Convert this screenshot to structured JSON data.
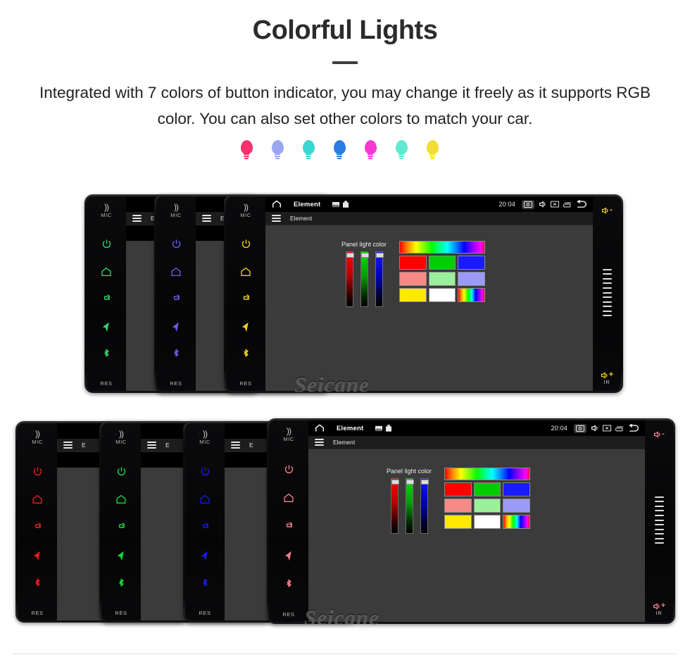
{
  "header": {
    "title": "Colorful Lights",
    "description": "Integrated with 7 colors of button indicator, you may change it freely as it supports RGB color. You can also set other colors to match your car."
  },
  "legend": {
    "icon": "bulb-icon",
    "items": [
      {
        "label": "red",
        "color": "#f8306b"
      },
      {
        "label": "Light blue",
        "color": "#9aa8f2"
      },
      {
        "label": "cyan",
        "color": "#3ad6d2"
      },
      {
        "label": "blue",
        "color": "#2a7de1"
      },
      {
        "label": "pink",
        "color": "#f738d0"
      },
      {
        "label": "light cyan",
        "color": "#62e8d0"
      },
      {
        "label": "yellow",
        "color": "#f2dd36"
      }
    ]
  },
  "device": {
    "brand_watermark": "Seicane",
    "left_panel": {
      "mic_label": "MIC",
      "reset_label": "RES",
      "keys": [
        {
          "name": "power-key",
          "icon": "power-icon"
        },
        {
          "name": "home-key",
          "icon": "home-icon"
        },
        {
          "name": "return-key",
          "icon": "return-arrow-icon"
        },
        {
          "name": "navigation-key",
          "icon": "navigation-arrow-icon"
        },
        {
          "name": "bluetooth-key",
          "icon": "bluetooth-icon"
        }
      ]
    },
    "right_panel": {
      "volume_down_label": "-",
      "volume_up_label": "+",
      "tick_count": 11,
      "ir_label": "IR"
    },
    "statusbar": {
      "home_icon": "home-icon",
      "title": "Element",
      "left_icons": [
        "image-icon",
        "usb-icon"
      ],
      "clock": "20:04",
      "right_icons": [
        "screenshot-icon",
        "mute-icon",
        "close-window-icon",
        "recents-icon",
        "back-icon"
      ]
    },
    "appbar": {
      "menu_icon": "hamburger-icon",
      "title": "Element"
    },
    "dialog": {
      "caption": "Panel light color",
      "sliders": [
        {
          "name": "red-slider",
          "value": 100
        },
        {
          "name": "green-slider",
          "value": 100
        },
        {
          "name": "blue-slider",
          "value": 100
        }
      ],
      "hue_strip": "hue-gradient",
      "swatch_rows": [
        [
          {
            "name": "swatch-red",
            "color": "#ff0000"
          },
          {
            "name": "swatch-green",
            "color": "#00cc00"
          },
          {
            "name": "swatch-blue",
            "color": "#1a1aff"
          }
        ],
        [
          {
            "name": "swatch-light-red",
            "color": "#f78a86"
          },
          {
            "name": "swatch-light-green",
            "color": "#9bf09b"
          },
          {
            "name": "swatch-light-blue",
            "color": "#9b9bf7"
          }
        ],
        [
          {
            "name": "swatch-yellow",
            "color": "#ffe800"
          },
          {
            "name": "swatch-white",
            "color": "#ffffff"
          },
          {
            "name": "swatch-rainbow",
            "color": "rainbow"
          }
        ]
      ]
    }
  },
  "groups": {
    "top": {
      "units": [
        {
          "name": "unit-green",
          "key_color": "#2fd66a"
        },
        {
          "name": "unit-purple",
          "key_color": "#6a5ce8"
        },
        {
          "name": "unit-yellow",
          "key_color": "#f0d11a"
        }
      ]
    },
    "bottom": {
      "units": [
        {
          "name": "unit-red",
          "key_color": "#ef1b24"
        },
        {
          "name": "unit-green",
          "key_color": "#19d93f"
        },
        {
          "name": "unit-blue",
          "key_color": "#1a1ae8"
        },
        {
          "name": "unit-pink",
          "key_color": "#f2808a"
        }
      ]
    }
  }
}
